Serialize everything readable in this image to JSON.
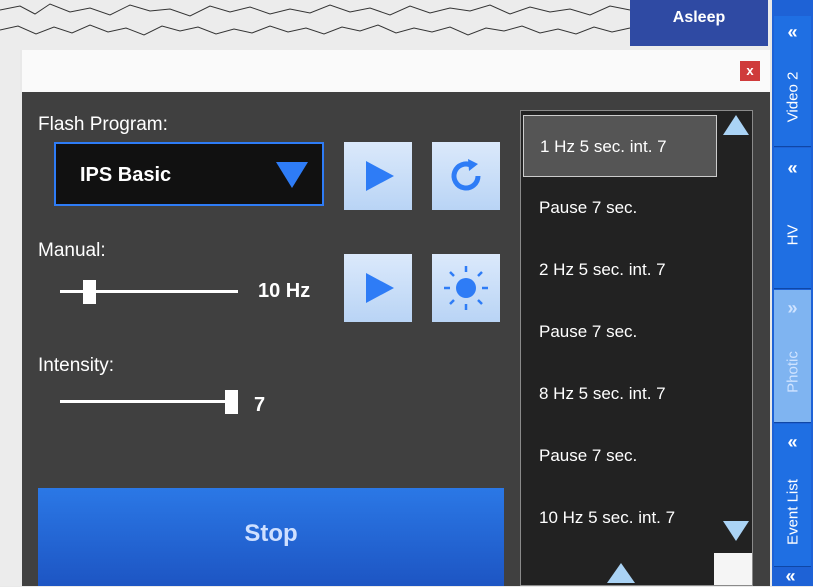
{
  "status": {
    "label": "Asleep"
  },
  "dialog": {
    "close_label": "x",
    "flash_program": {
      "label": "Flash Program:",
      "selected": "IPS Basic"
    },
    "manual": {
      "label": "Manual:",
      "value_text": "10 Hz",
      "slider_fraction": 0.2
    },
    "intensity": {
      "label": "Intensity:",
      "value_text": "7",
      "slider_fraction": 1.0
    },
    "stop_label": "Stop",
    "steps": [
      "1 Hz 5 sec. int. 7",
      "Pause 7 sec.",
      "2 Hz 5 sec. int. 7",
      "Pause 7 sec.",
      "8 Hz 5 sec. int. 7",
      "Pause 7 sec.",
      "10 Hz 5 sec. int. 7"
    ],
    "selected_step": 0
  },
  "rail": {
    "tabs": [
      {
        "label": "Video 2",
        "chevron": "«"
      },
      {
        "label": "HV",
        "chevron": "«"
      },
      {
        "label": "Photic",
        "chevron": "»"
      },
      {
        "label": "Event List",
        "chevron": "«"
      }
    ],
    "bottom_chevron": "«"
  },
  "colors": {
    "accent": "#2e7cf6",
    "status_badge": "#2f4aa3",
    "close": "#cf3b3b",
    "rail": "#1f6fe3"
  }
}
